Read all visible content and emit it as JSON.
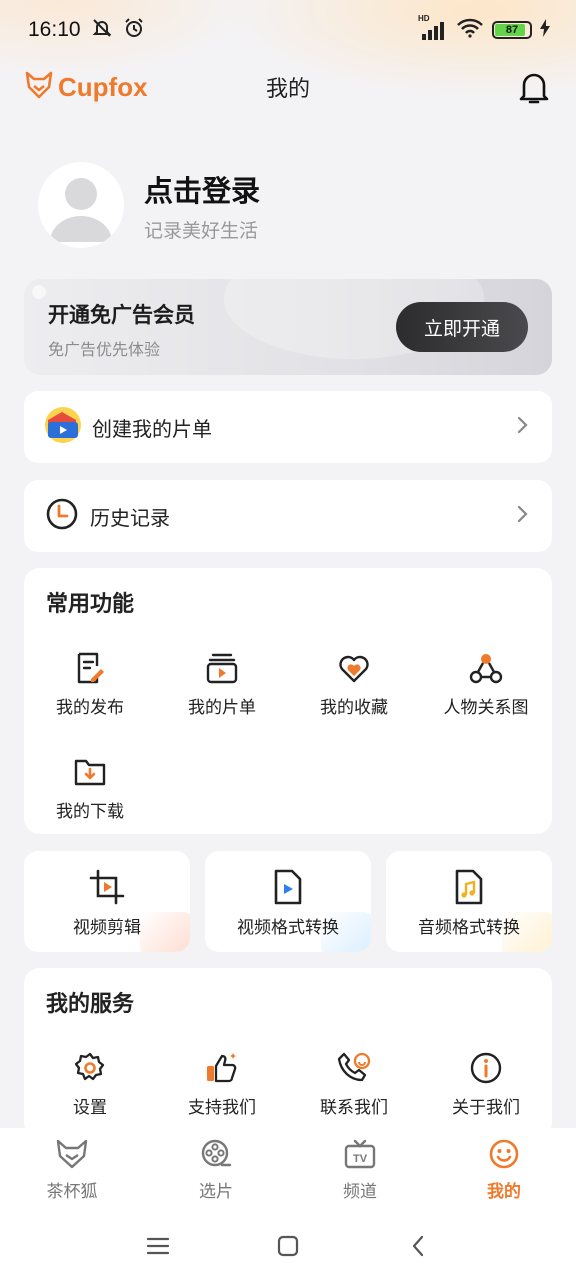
{
  "status_bar": {
    "time": "16:10",
    "network": "HD",
    "battery": "87"
  },
  "header": {
    "logo_text": "Cupfox",
    "title": "我的"
  },
  "profile": {
    "login_title": "点击登录",
    "login_subtitle": "记录美好生活"
  },
  "vip": {
    "title": "开通免广告会员",
    "subtitle": "免广告优先体验",
    "button": "立即开通"
  },
  "rows": [
    {
      "label": "创建我的片单",
      "icon": "playlist-colorful-icon"
    },
    {
      "label": "历史记录",
      "icon": "clock-icon"
    }
  ],
  "common": {
    "title": "常用功能",
    "items": [
      {
        "label": "我的发布",
        "icon": "edit-doc-icon"
      },
      {
        "label": "我的片单",
        "icon": "playlist-icon"
      },
      {
        "label": "我的收藏",
        "icon": "heart-icon"
      },
      {
        "label": "人物关系图",
        "icon": "relation-graph-icon"
      },
      {
        "label": "我的下载",
        "icon": "download-folder-icon"
      }
    ]
  },
  "tools": [
    {
      "label": "视频剪辑",
      "icon": "crop-icon",
      "accent": "#ffd9cc"
    },
    {
      "label": "视频格式转换",
      "icon": "video-file-icon",
      "accent": "#d6ecff"
    },
    {
      "label": "音频格式转换",
      "icon": "audio-file-icon",
      "accent": "#ffefcc"
    }
  ],
  "services": {
    "title": "我的服务",
    "items": [
      {
        "label": "设置",
        "icon": "gear-icon"
      },
      {
        "label": "支持我们",
        "icon": "thumbs-up-icon"
      },
      {
        "label": "联系我们",
        "icon": "phone-icon"
      },
      {
        "label": "关于我们",
        "icon": "info-icon"
      }
    ]
  },
  "bottom_nav": [
    {
      "label": "茶杯狐",
      "icon": "fox-icon",
      "active": false
    },
    {
      "label": "选片",
      "icon": "film-reel-icon",
      "active": false
    },
    {
      "label": "频道",
      "icon": "tv-icon",
      "active": false
    },
    {
      "label": "我的",
      "icon": "smile-icon",
      "active": true
    }
  ],
  "colors": {
    "accent": "#f07a2b",
    "page_bg": "#f3f3f6"
  }
}
